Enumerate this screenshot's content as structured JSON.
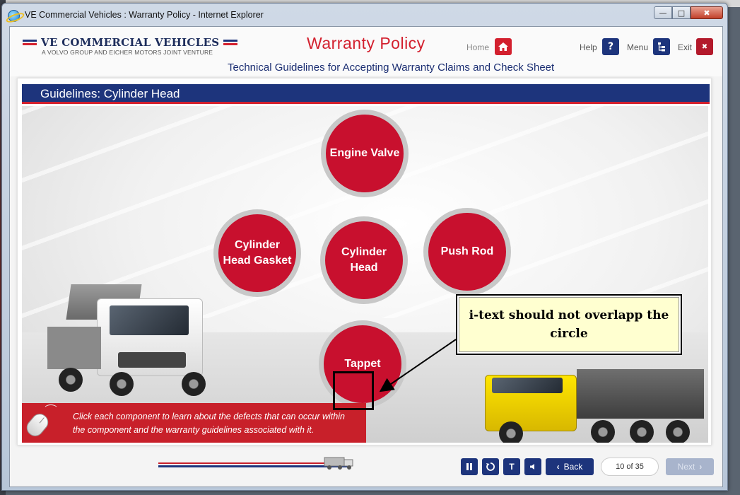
{
  "window": {
    "title": "VE Commercial Vehicles : Warranty Policy - Internet Explorer",
    "minimize": "—",
    "maximize": "□",
    "close": "✖"
  },
  "header": {
    "logo_name": "VE COMMERCIAL VEHICLES",
    "logo_sub": "A VOLVO GROUP AND EICHER MOTORS JOINT VENTURE",
    "title": "Warranty Policy",
    "subtitle": "Technical Guidelines for Accepting Warranty Claims and Check Sheet",
    "home_label": "Home",
    "help_label": "Help",
    "help_icon": "?",
    "menu_label": "Menu",
    "exit_label": "Exit",
    "exit_icon": "✖",
    "colors": {
      "red": "#d3202e",
      "navy": "#1d347c"
    }
  },
  "section": {
    "title": "Guidelines: Cylinder Head"
  },
  "components": [
    {
      "label": "Engine Valve"
    },
    {
      "label": "Cylinder Head Gasket"
    },
    {
      "label": "Cylinder Head"
    },
    {
      "label": "Push Rod"
    },
    {
      "label": "Tappet"
    }
  ],
  "instruction": {
    "text": "Click each component to learn about the defects that can occur within the component and the warranty guidelines associated with it."
  },
  "annotation": {
    "text": "i-text should not overlapp the circle"
  },
  "footer": {
    "back_label": "Back",
    "page_indicator": "10 of 35",
    "next_label": "Next",
    "progress": 0.286
  }
}
